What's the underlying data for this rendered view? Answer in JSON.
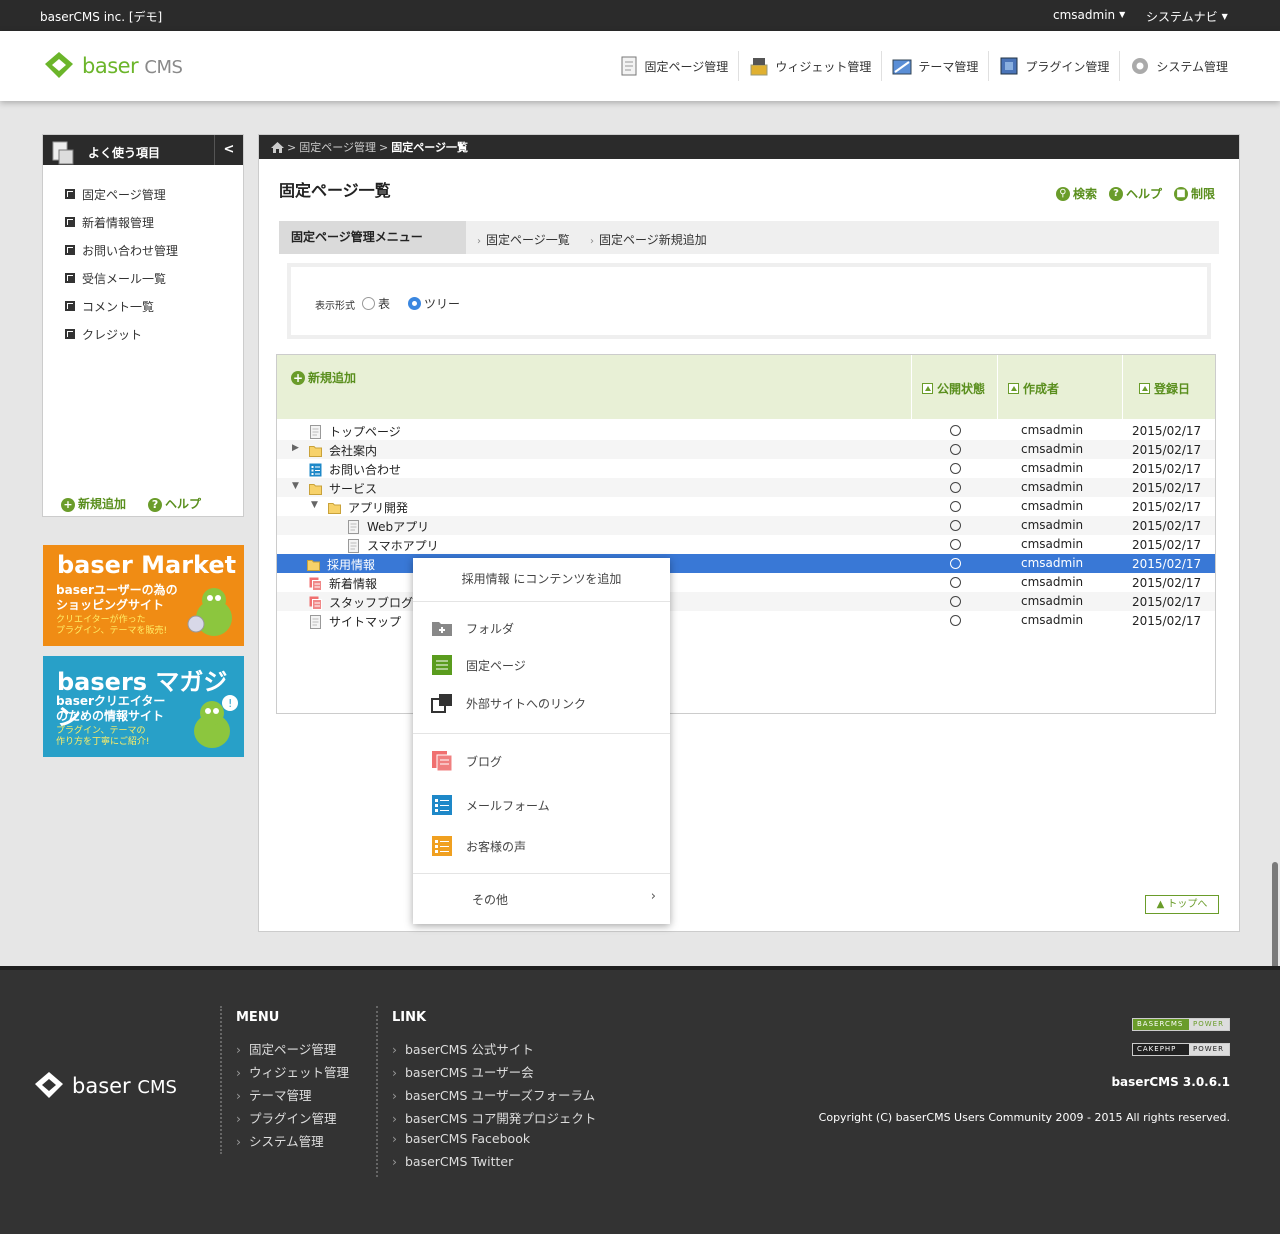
{
  "topbar": {
    "site_name": "baserCMS inc. [デモ]",
    "user_menu": "cmsadmin",
    "system_nav": "システムナビ"
  },
  "header": {
    "logo_baser": "baser",
    "logo_cms": "CMS",
    "nav": [
      {
        "label": "固定ページ管理",
        "icon": "page-icon"
      },
      {
        "label": "ウィジェット管理",
        "icon": "widget-icon"
      },
      {
        "label": "テーマ管理",
        "icon": "theme-icon"
      },
      {
        "label": "プラグイン管理",
        "icon": "plugin-icon"
      },
      {
        "label": "システム管理",
        "icon": "gear-icon"
      }
    ]
  },
  "sidebar": {
    "title": "よく使う項目",
    "collapse": "<",
    "items": [
      "固定ページ管理",
      "新着情報管理",
      "お問い合わせ管理",
      "受信メール一覧",
      "コメント一覧",
      "クレジット"
    ],
    "footer_add": "新規追加",
    "footer_help": "ヘルプ"
  },
  "banners": {
    "market": {
      "title": "baser Market",
      "line1": "baserユーザーの為の",
      "line2": "ショッピングサイト",
      "small1": "クリエイターが作った",
      "small2": "プラグイン、テーマを販売!",
      "color": "#f08c14"
    },
    "magazine": {
      "title": "basers マガジン",
      "line1": "baserクリエイター",
      "line2": "のための情報サイト",
      "small1": "プラグイン、テーマの",
      "small2": "作り方を丁寧にご紹介!",
      "color": "#28a0c8"
    }
  },
  "breadcrumb": {
    "home_sep": ">",
    "parent": "固定ページ管理",
    "sep": ">",
    "current": "固定ページ一覧"
  },
  "page": {
    "title": "固定ページ一覧",
    "tools": {
      "search": "検索",
      "help": "ヘルプ",
      "restrict": "制限"
    }
  },
  "submenu": {
    "label": "固定ページ管理メニュー",
    "links": [
      "固定ページ一覧",
      "固定ページ新規追加"
    ]
  },
  "view_mode": {
    "label": "表示形式",
    "options": [
      "表",
      "ツリー"
    ],
    "selected": "ツリー"
  },
  "table": {
    "add_label": "新規追加",
    "columns": [
      "公開状態",
      "作成者",
      "登録日"
    ],
    "rows": [
      {
        "name": "トップページ",
        "icon": "page-icon",
        "level": 0,
        "toggle": "",
        "author": "cmsadmin",
        "date": "2015/02/17"
      },
      {
        "name": "会社案内",
        "icon": "folder-icon",
        "level": 0,
        "toggle": "▶",
        "author": "cmsadmin",
        "date": "2015/02/17"
      },
      {
        "name": "お問い合わせ",
        "icon": "mailform-icon",
        "level": 0,
        "toggle": "",
        "author": "cmsadmin",
        "date": "2015/02/17"
      },
      {
        "name": "サービス",
        "icon": "folder-icon",
        "level": 0,
        "toggle": "▼",
        "author": "cmsadmin",
        "date": "2015/02/17"
      },
      {
        "name": "アプリ開発",
        "icon": "folder-icon",
        "level": 1,
        "toggle": "▼",
        "author": "cmsadmin",
        "date": "2015/02/17"
      },
      {
        "name": "Webアプリ",
        "icon": "page-icon",
        "level": 2,
        "toggle": "",
        "author": "cmsadmin",
        "date": "2015/02/17"
      },
      {
        "name": "スマホアプリ",
        "icon": "page-icon",
        "level": 2,
        "toggle": "",
        "author": "cmsadmin",
        "date": "2015/02/17"
      },
      {
        "name": "採用情報",
        "icon": "folder-icon",
        "level": 0,
        "toggle": "",
        "author": "cmsadmin",
        "date": "2015/02/17",
        "selected": true
      },
      {
        "name": "新着情報",
        "icon": "blog-icon",
        "level": 0,
        "toggle": "",
        "author": "cmsadmin",
        "date": "2015/02/17"
      },
      {
        "name": "スタッフブログ",
        "icon": "blog-icon",
        "level": 0,
        "toggle": "",
        "author": "cmsadmin",
        "date": "2015/02/17"
      },
      {
        "name": "サイトマップ",
        "icon": "page-icon",
        "level": 0,
        "toggle": "",
        "author": "cmsadmin",
        "date": "2015/02/17"
      }
    ]
  },
  "context_menu": {
    "title": "採用情報 にコンテンツを追加",
    "items": [
      {
        "label": "フォルダ",
        "icon": "folder-add-icon"
      },
      {
        "label": "固定ページ",
        "icon": "page-green-icon"
      },
      {
        "label": "外部サイトへのリンク",
        "icon": "link-icon"
      },
      {
        "label": "ブログ",
        "icon": "blog-icon"
      },
      {
        "label": "メールフォーム",
        "icon": "mailform-icon"
      },
      {
        "label": "お客様の声",
        "icon": "voice-icon"
      }
    ],
    "more": "その他",
    "more_chevron": "›"
  },
  "to_top": "▲ トップへ",
  "footer": {
    "menu_heading": "MENU",
    "menu": [
      "固定ページ管理",
      "ウィジェット管理",
      "テーマ管理",
      "プラグイン管理",
      "システム管理"
    ],
    "link_heading": "LINK",
    "links": [
      "baserCMS 公式サイト",
      "baserCMS ユーザー会",
      "baserCMS ユーザーズフォーラム",
      "baserCMS コア開発プロジェクト",
      "baserCMS Facebook",
      "baserCMS Twitter"
    ],
    "badge1": [
      "BASERCMS",
      "POWER"
    ],
    "badge2": [
      "CAKEPHP",
      "POWER"
    ],
    "version": "baserCMS 3.0.6.1",
    "copyright": "Copyright (C) baserCMS Users Community 2009 - 2015 All rights reserved."
  },
  "colors": {
    "accent_green": "#6a9c2a",
    "dark_bar": "#2b2b2b",
    "selection_blue": "#3978d6"
  }
}
